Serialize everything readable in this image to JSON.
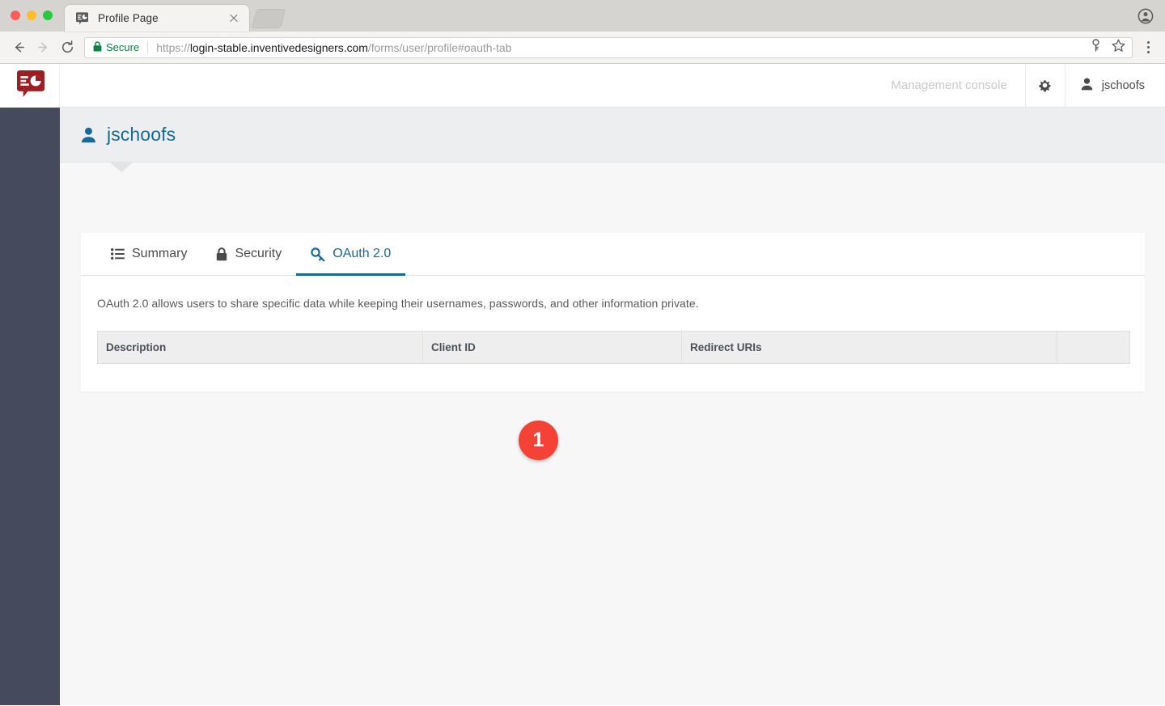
{
  "browser": {
    "tab": {
      "title": "Profile Page",
      "favicon": "app-logo-icon",
      "close": "close-icon"
    },
    "new_tab_label": "new-tab",
    "back_icon": "back-arrow-icon",
    "forward_icon": "forward-arrow-icon",
    "reload_icon": "reload-icon",
    "security_label": "Secure",
    "lock_icon": "lock-icon",
    "url": {
      "full": "https://login-stable.inventivedesigners.com/forms/user/profile#oauth-tab",
      "scheme": "https://",
      "host": "login-stable.inventivedesigners.com",
      "path": "/forms/user/profile#oauth-tab"
    },
    "save_password_icon": "key-icon",
    "bookmark_icon": "star-icon",
    "menu_icon": "kebab-menu-icon",
    "profile_icon": "account-circle-icon"
  },
  "topbar": {
    "logo": "inventive-designers-logo",
    "management_console": "Management console",
    "settings_icon": "gear-icon",
    "user_icon": "user-icon",
    "username": "jschoofs"
  },
  "page": {
    "icon": "user-icon",
    "title": "jschoofs"
  },
  "tabs": [
    {
      "label": "Summary",
      "icon": "list-icon",
      "active": false
    },
    {
      "label": "Security",
      "icon": "lock-icon",
      "active": false
    },
    {
      "label": "OAuth 2.0",
      "icon": "key-icon",
      "active": true
    }
  ],
  "oauth": {
    "description": "OAuth 2.0 allows users to share specific data while keeping their usernames, passwords, and other information private.",
    "table": {
      "headers": [
        "Description",
        "Client ID",
        "Redirect URIs",
        ""
      ],
      "rows": []
    }
  },
  "marker": {
    "label": "1",
    "color": "#f44336"
  },
  "colors": {
    "accent": "#186a96",
    "sidebar": "#454a5c",
    "logo": "#9b1f24",
    "header_band": "#edeef0",
    "page_bg": "#f7f7f8",
    "secure_green": "#0b8043"
  }
}
